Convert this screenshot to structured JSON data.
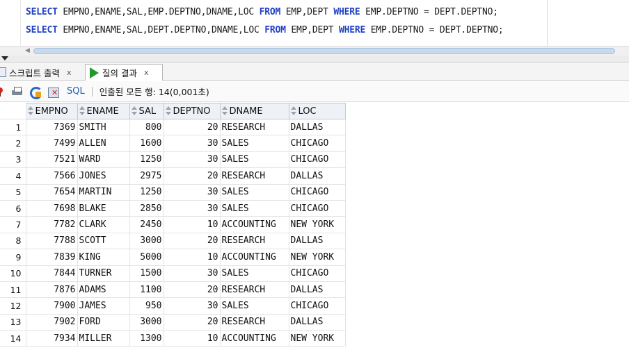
{
  "editor": {
    "lines": [
      {
        "k1": "SELECT",
        "t1": " EMPNO,ENAME,SAL,EMP.DEPTNO,DNAME,LOC ",
        "k2": "FROM",
        "t2": " EMP,DEPT ",
        "k3": "WHERE",
        "t3": " EMP.DEPTNO = DEPT.DEPTNO;"
      },
      {
        "k1": "SELECT",
        "t1": " EMPNO,ENAME,SAL,DEPT.DEPTNO,DNAME,LOC ",
        "k2": "FROM",
        "t2": " EMP,DEPT ",
        "k3": "WHERE",
        "t3": " EMP.DEPTNO = DEPT.DEPTNO;"
      }
    ]
  },
  "tabs": [
    {
      "label": "스크립트 출력",
      "close": "x",
      "icon": "script-output-icon"
    },
    {
      "label": "질의 결과",
      "close": "x",
      "icon": "run-icon"
    }
  ],
  "toolbar": {
    "sql_label": "SQL",
    "status": "인출된 모든 행: 14(0,001초)"
  },
  "grid": {
    "columns": [
      "EMPNO",
      "ENAME",
      "SAL",
      "DEPTNO",
      "DNAME",
      "LOC"
    ],
    "rows": [
      [
        "1",
        "7369",
        "SMITH",
        "800",
        "20",
        "RESEARCH",
        "DALLAS"
      ],
      [
        "2",
        "7499",
        "ALLEN",
        "1600",
        "30",
        "SALES",
        "CHICAGO"
      ],
      [
        "3",
        "7521",
        "WARD",
        "1250",
        "30",
        "SALES",
        "CHICAGO"
      ],
      [
        "4",
        "7566",
        "JONES",
        "2975",
        "20",
        "RESEARCH",
        "DALLAS"
      ],
      [
        "5",
        "7654",
        "MARTIN",
        "1250",
        "30",
        "SALES",
        "CHICAGO"
      ],
      [
        "6",
        "7698",
        "BLAKE",
        "2850",
        "30",
        "SALES",
        "CHICAGO"
      ],
      [
        "7",
        "7782",
        "CLARK",
        "2450",
        "10",
        "ACCOUNTING",
        "NEW YORK"
      ],
      [
        "8",
        "7788",
        "SCOTT",
        "3000",
        "20",
        "RESEARCH",
        "DALLAS"
      ],
      [
        "9",
        "7839",
        "KING",
        "5000",
        "10",
        "ACCOUNTING",
        "NEW YORK"
      ],
      [
        "10",
        "7844",
        "TURNER",
        "1500",
        "30",
        "SALES",
        "CHICAGO"
      ],
      [
        "11",
        "7876",
        "ADAMS",
        "1100",
        "20",
        "RESEARCH",
        "DALLAS"
      ],
      [
        "12",
        "7900",
        "JAMES",
        "950",
        "30",
        "SALES",
        "CHICAGO"
      ],
      [
        "13",
        "7902",
        "FORD",
        "3000",
        "20",
        "RESEARCH",
        "DALLAS"
      ],
      [
        "14",
        "7934",
        "MILLER",
        "1300",
        "10",
        "ACCOUNTING",
        "NEW YORK"
      ]
    ]
  }
}
